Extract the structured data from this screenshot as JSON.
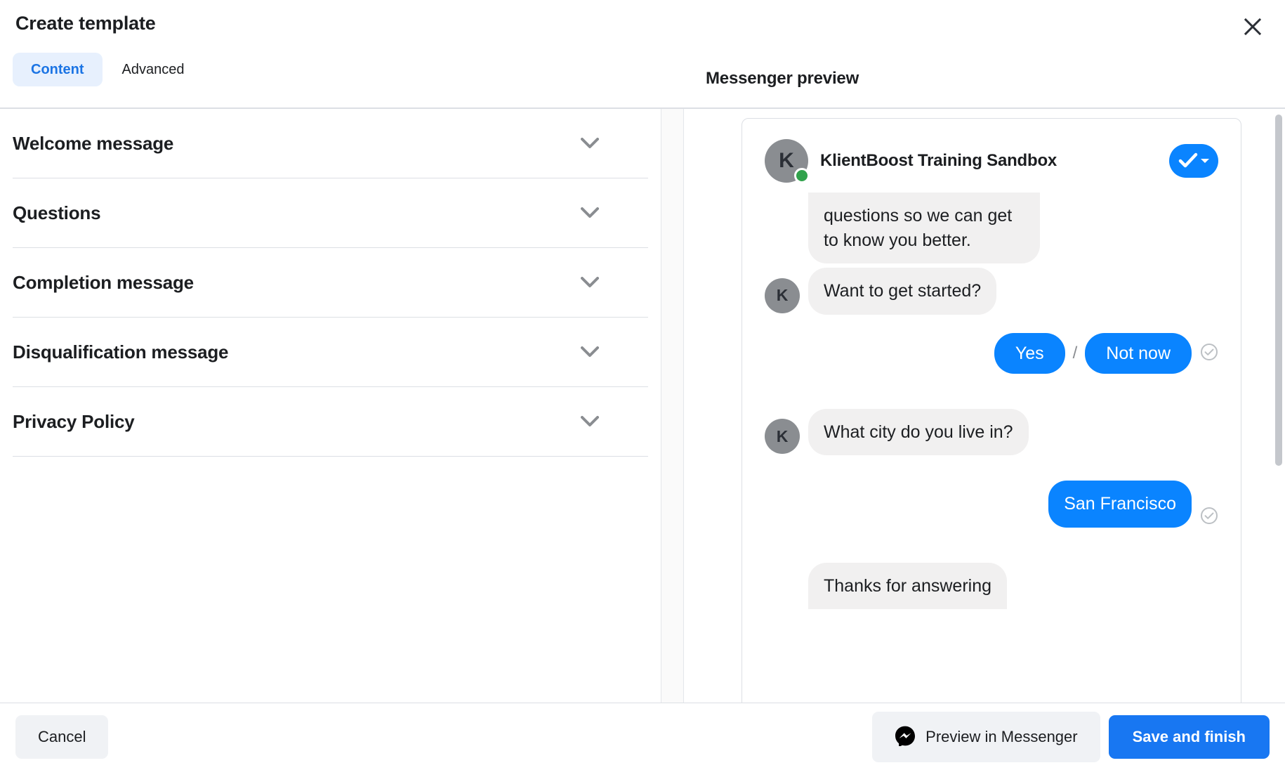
{
  "header": {
    "title": "Create template",
    "close_icon": "close-icon",
    "tabs": [
      {
        "label": "Content",
        "active": true
      },
      {
        "label": "Advanced",
        "active": false
      }
    ]
  },
  "left_panel": {
    "sections": [
      {
        "label": "Welcome message",
        "icon": "chevron-down-icon",
        "expanded": false
      },
      {
        "label": "Questions",
        "icon": "chevron-down-icon",
        "expanded": false
      },
      {
        "label": "Completion message",
        "icon": "chevron-down-icon",
        "expanded": false
      },
      {
        "label": "Disqualification message",
        "icon": "chevron-down-icon",
        "expanded": false
      },
      {
        "label": "Privacy Policy",
        "icon": "chevron-down-icon",
        "expanded": false
      }
    ]
  },
  "preview": {
    "heading": "Messenger preview",
    "chat_header": {
      "avatar_initial": "K",
      "page_name": "KlientBoost Training Sandbox",
      "online_badge": "online-status-dot",
      "verified_button": {
        "icon": "check-icon",
        "dropdown_icon": "caret-down-icon"
      }
    },
    "messages": [
      {
        "id": "m1",
        "direction": "in",
        "text": "questions so we can get to know you better.",
        "clipped_top": true,
        "avatar_initial": "",
        "show_avatar": false
      },
      {
        "id": "m2",
        "direction": "in",
        "text": "Want to get started?",
        "avatar_initial": "K",
        "show_avatar": true
      },
      {
        "id": "m3",
        "direction": "out",
        "type": "quick_replies",
        "options": [
          "Yes",
          "Not now"
        ],
        "separator": "/",
        "receipt_icon": "delivered-check-icon"
      },
      {
        "id": "m4",
        "direction": "in",
        "text": "What city do you live in?",
        "avatar_initial": "K",
        "show_avatar": true
      },
      {
        "id": "m5",
        "direction": "out",
        "text": "San Francisco",
        "receipt_icon": "delivered-check-icon"
      },
      {
        "id": "m6",
        "direction": "in",
        "text": "Thanks for answering",
        "clipped_bottom": true,
        "show_avatar": false
      }
    ],
    "scrollbar": "preview-scrollbar"
  },
  "footer": {
    "cancel_label": "Cancel",
    "preview_label": "Preview in Messenger",
    "preview_icon": "messenger-icon",
    "save_label": "Save and finish"
  },
  "colors": {
    "accent_blue": "#1877f2",
    "bubble_blue": "#0a84ff",
    "tab_active_bg": "#e7f0fd",
    "tab_active_text": "#1b74e4",
    "bubble_gray": "#f1f0f0",
    "avatar_gray": "#8a8d91",
    "online_green": "#31a24c",
    "button_gray": "#f0f2f5",
    "divider": "#dcdfe4",
    "text_primary": "#1c1e21"
  }
}
